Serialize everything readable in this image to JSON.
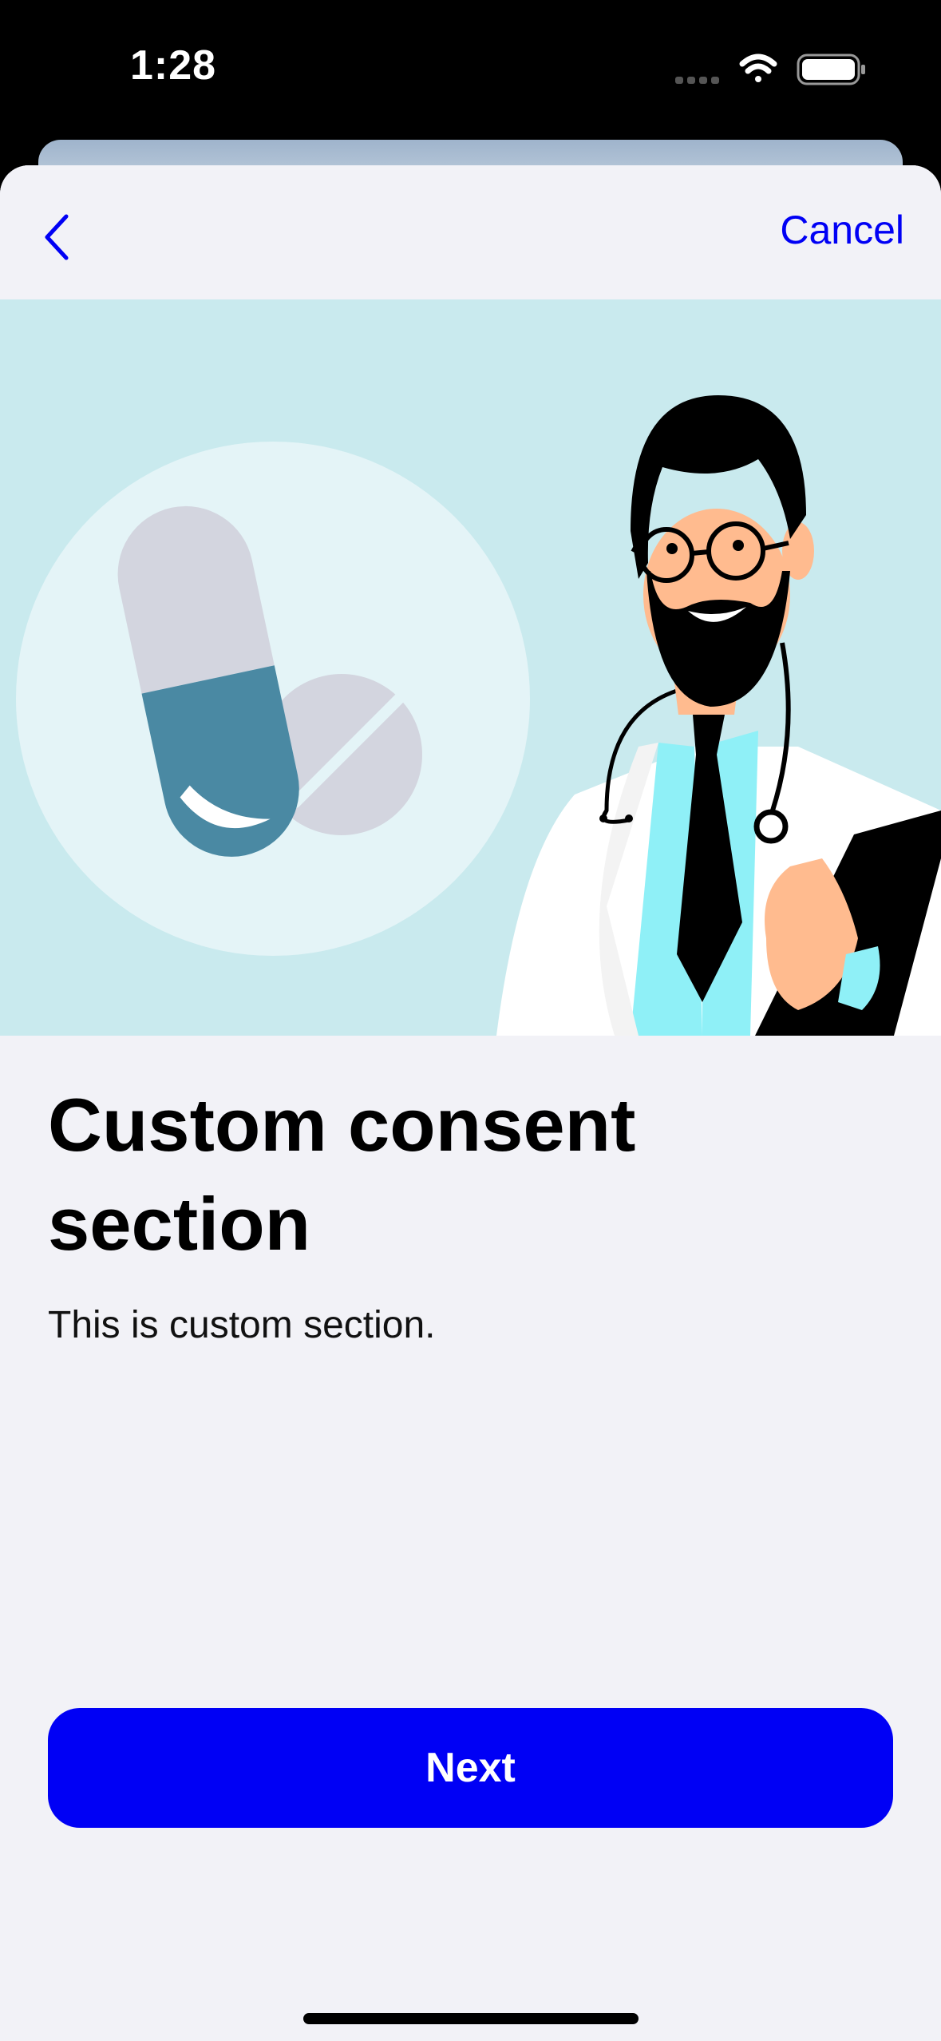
{
  "status_bar": {
    "time": "1:28",
    "icons": [
      "cellular-icon",
      "wifi-icon",
      "battery-icon"
    ]
  },
  "nav": {
    "back_icon": "chevron-left-icon",
    "cancel_label": "Cancel"
  },
  "hero": {
    "image": "doctor-and-pills-illustration"
  },
  "content": {
    "title": "Custom consent section",
    "body": "This is custom section."
  },
  "actions": {
    "next_label": "Next"
  },
  "colors": {
    "accent": "#0000f5",
    "sheet_background": "#f2f2f7",
    "hero_background": "#c9eaee",
    "pill_blue": "#4a89a3",
    "pill_gray": "#d3d5df"
  }
}
